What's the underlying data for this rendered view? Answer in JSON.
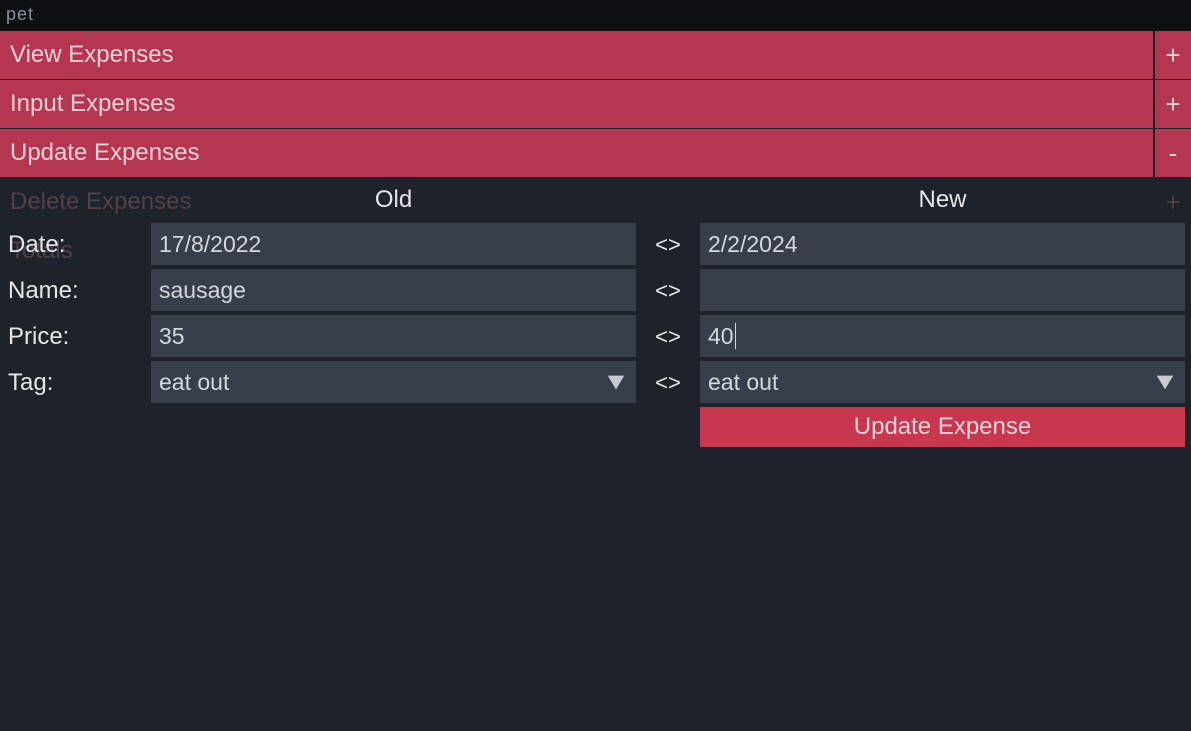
{
  "title": "pet",
  "nav": {
    "items": [
      {
        "label": "View Expenses",
        "toggle": "+",
        "variant": "red"
      },
      {
        "label": "Input Expenses",
        "toggle": "+",
        "variant": "red"
      },
      {
        "label": "Update Expenses",
        "toggle": "-",
        "variant": "red"
      },
      {
        "label": "Delete Expenses",
        "toggle": "+",
        "variant": "dim"
      },
      {
        "label": "Totals",
        "toggle": "+",
        "variant": "dim"
      }
    ]
  },
  "headers": {
    "old": "Old",
    "new": "New"
  },
  "separator": "<>",
  "labels": {
    "date": "Date:",
    "name": "Name:",
    "price": "Price:",
    "tag": "Tag:"
  },
  "old": {
    "date": "17/8/2022",
    "name": "sausage",
    "price": "35",
    "tag": "eat out"
  },
  "new": {
    "date": "2/2/2024",
    "name": "",
    "price": "40",
    "tag": "eat out"
  },
  "button": {
    "update": "Update Expense"
  }
}
